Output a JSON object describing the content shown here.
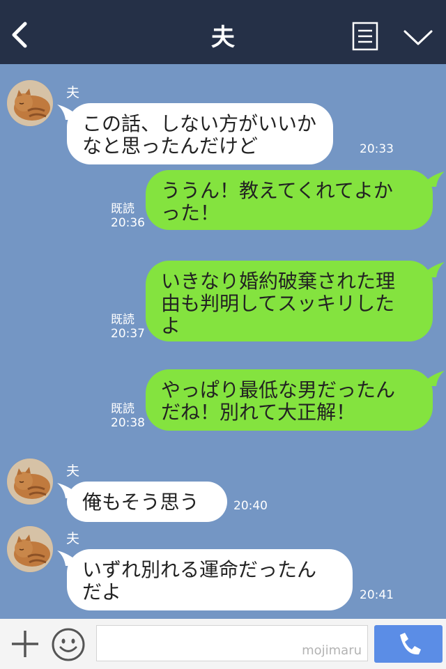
{
  "header": {
    "title": "夫",
    "back_icon": "chevron-left-icon",
    "notes_icon": "notes-icon",
    "menu_icon": "chevron-down-icon"
  },
  "messages": [
    {
      "side": "in",
      "sender": "夫",
      "lines": [
        "この話、しない方がいいか",
        "なと思ったんだけど"
      ],
      "time": "20:33"
    },
    {
      "side": "out",
      "read": "既読",
      "lines": [
        "ううん！教えてくれてよか",
        "った！"
      ],
      "time": "20:36"
    },
    {
      "side": "out",
      "read": "既読",
      "lines": [
        "いきなり婚約破棄された理",
        "由も判明してスッキリした",
        "よ"
      ],
      "time": "20:37"
    },
    {
      "side": "out",
      "read": "既読",
      "lines": [
        "やっぱり最低な男だったん",
        "だね！別れて大正解！"
      ],
      "time": "20:38"
    },
    {
      "side": "in",
      "sender": "夫",
      "lines": [
        "俺もそう思う"
      ],
      "time": "20:40"
    },
    {
      "side": "in",
      "sender": "夫",
      "lines": [
        "いずれ別れる運命だったん",
        "だよ"
      ],
      "time": "20:41"
    }
  ],
  "footer": {
    "plus_icon": "plus-icon",
    "emoji_icon": "smiley-icon",
    "input_value": "",
    "watermark": "mojimaru",
    "call_icon": "phone-icon"
  },
  "colors": {
    "header_bg": "#253047",
    "chat_bg": "#7496c4",
    "incoming_bubble": "#ffffff",
    "outgoing_bubble": "#84e33f",
    "call_button": "#5b8de6"
  }
}
